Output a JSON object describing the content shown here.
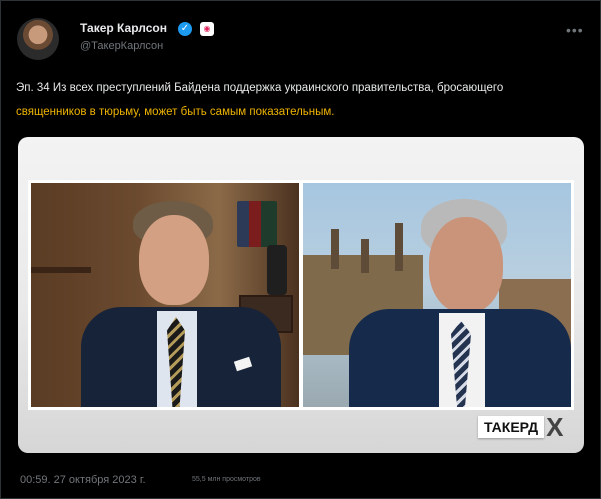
{
  "tweet": {
    "author_name": "Такер Карлсон",
    "handle": "@ТакерКарлсон",
    "text_line1": "Эп. 34 Из всех преступлений Байдена поддержка украинского правительства, бросающего",
    "text_line2": "священников в тюрьму, может быть самым показательным.",
    "timestamp": "00:59. 27 октября 2023 г.",
    "views": "55,5 млн просмотров"
  },
  "icons": {
    "verified": "verified-check-icon",
    "affiliation": "affiliation-badge-icon",
    "more": "more-options-icon"
  },
  "media": {
    "logo_text": "ТАКЕРД",
    "logo_mark": "X"
  },
  "colors": {
    "background": "#000000",
    "text": "#e7e9ea",
    "muted": "#71767b",
    "highlight": "#f0b400",
    "verified": "#1d9bf0"
  }
}
